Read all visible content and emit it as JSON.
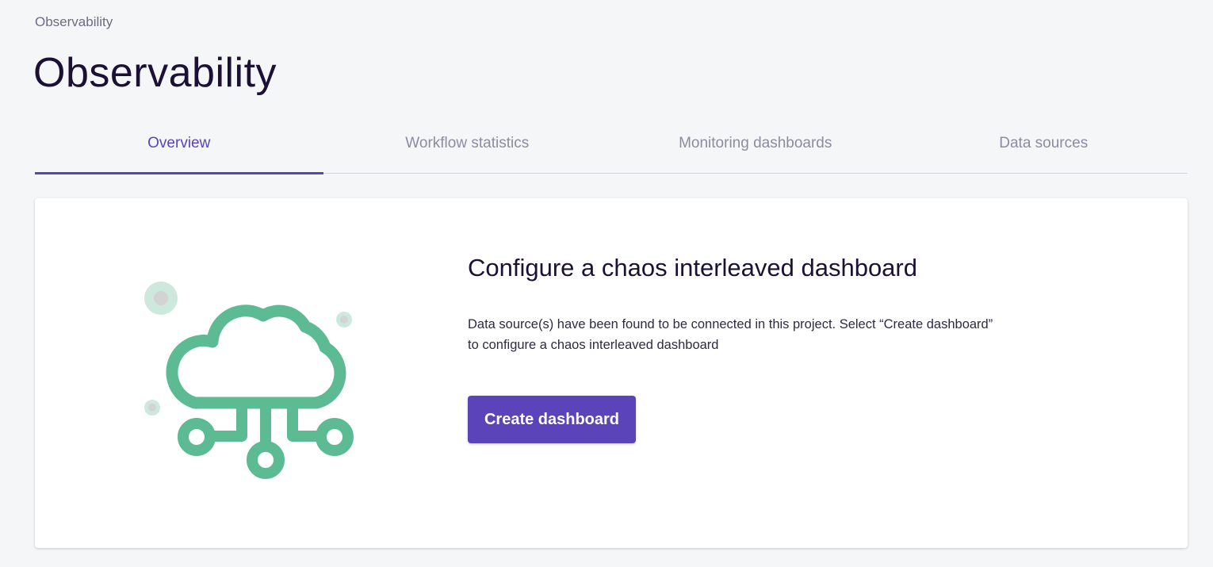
{
  "breadcrumb": {
    "label": "Observability"
  },
  "page": {
    "title": "Observability"
  },
  "tabs": [
    {
      "label": "Overview",
      "active": true
    },
    {
      "label": "Workflow statistics",
      "active": false
    },
    {
      "label": "Monitoring dashboards",
      "active": false
    },
    {
      "label": "Data sources",
      "active": false
    }
  ],
  "card": {
    "illustration_icon": "cloud-network-icon",
    "title": "Configure a chaos interleaved dashboard",
    "description_line1": "Data source(s) have been found to be connected in this project. Select “Create dashboard”",
    "description_line2": "to configure a chaos interleaved dashboard",
    "button_label": "Create dashboard"
  },
  "colors": {
    "accent": "#5b44ba",
    "illustration": "#5cbb93",
    "background": "#f5f6f8"
  }
}
